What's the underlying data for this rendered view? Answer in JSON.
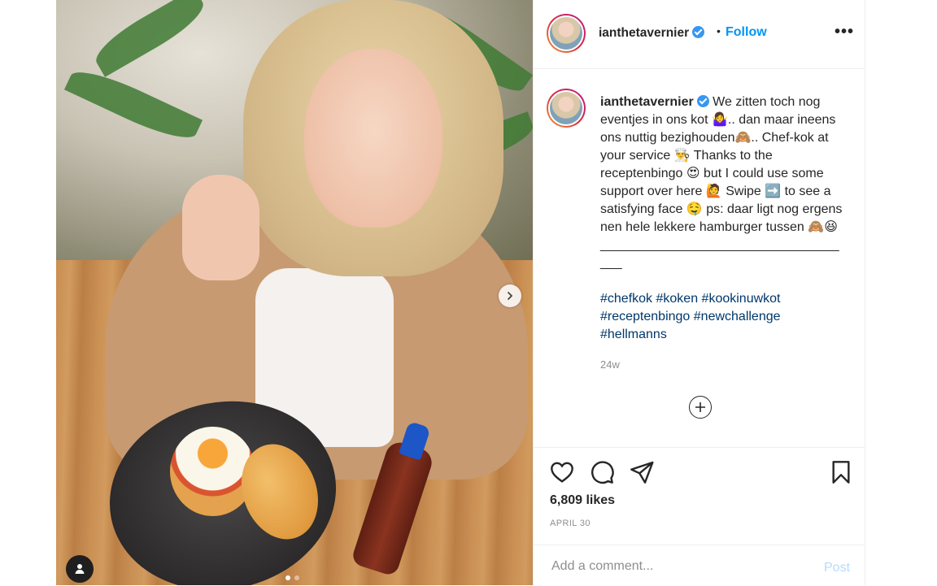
{
  "post": {
    "username": "ianthetavernier",
    "follow_label": "Follow",
    "header_separator": "•",
    "more_label": "•••",
    "caption_text": "We zitten toch nog eventjes in ons kot 🤷‍♀️.. dan maar ineens ons nuttig bezighouden🙈.. Chef-kok at your service 👨‍🍳 Thanks to the receptenbingo 😍 but I could use some support over here 🙋 Swipe ➡️ to see a satisfying face 🤤 ps: daar ligt nog ergens nen hele lekkere hamburger tussen 🙈😆",
    "caption_divider": "____________________________________",
    "hashtags": [
      "#chefkok",
      "#koken",
      "#kookinuwkot",
      "#receptenbingo",
      "#newchallenge",
      "#hellmanns"
    ],
    "time_ago": "24w",
    "likes": "6,809 likes",
    "date": "APRIL 30",
    "comment_placeholder": "Add a comment...",
    "post_label": "Post"
  },
  "carousel": {
    "slide_count": 2,
    "active_index": 0
  },
  "icons": {
    "next": "chevron-right-icon",
    "tag": "user-tag-icon",
    "like": "heart-icon",
    "comment": "comment-icon",
    "share": "send-icon",
    "save": "bookmark-icon",
    "add": "plus-circle-icon",
    "verified": "verified-badge-icon"
  },
  "colors": {
    "link_blue": "#0095f6",
    "verified_blue": "#3897f0",
    "hashtag": "#00376b",
    "muted": "#8e8e8e",
    "post_disabled": "#b3dbff"
  }
}
